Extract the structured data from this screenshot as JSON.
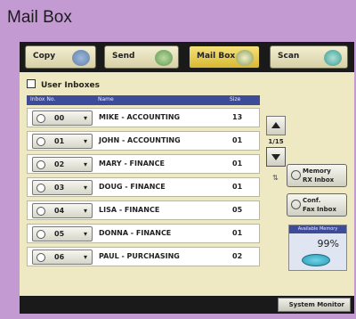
{
  "window": {
    "title": "Mail Box"
  },
  "tabs": [
    {
      "label": "Copy",
      "active": false,
      "icon": "copy-icon"
    },
    {
      "label": "Send",
      "active": false,
      "icon": "send-icon"
    },
    {
      "label": "Mail Box",
      "active": true,
      "icon": "mailbox-icon"
    },
    {
      "label": "Scan",
      "active": false,
      "icon": "scan-icon"
    }
  ],
  "inbox": {
    "header": "User Inboxes",
    "columns": {
      "no": "Inbox No.",
      "name": "Name",
      "usage": "Size"
    },
    "rows": [
      {
        "no": "00",
        "name": "MIKE - ACCOUNTING",
        "usage": "13"
      },
      {
        "no": "01",
        "name": "JOHN - ACCOUNTING",
        "usage": "01"
      },
      {
        "no": "02",
        "name": "MARY - FINANCE",
        "usage": "01"
      },
      {
        "no": "03",
        "name": "DOUG - FINANCE",
        "usage": "01"
      },
      {
        "no": "04",
        "name": "LISA - FINANCE",
        "usage": "05"
      },
      {
        "no": "05",
        "name": "DONNA - FINANCE",
        "usage": "01"
      },
      {
        "no": "06",
        "name": "PAUL - PURCHASING",
        "usage": "02"
      }
    ]
  },
  "pager": {
    "page": "1/15"
  },
  "side": {
    "memory_rx": {
      "line1": "Memory",
      "line2": "RX Inbox"
    },
    "confidential": {
      "line1": "Conf.",
      "line2": "Fax Inbox"
    }
  },
  "memory": {
    "label": "Available Memory",
    "percent": "99%"
  },
  "footer": {
    "system_monitor": "System Monitor"
  },
  "colors": {
    "frame": "#c39ad2",
    "screen": "#eee9c2",
    "header_blue": "#3d4c9a",
    "active_tab": "#f6e27a"
  }
}
